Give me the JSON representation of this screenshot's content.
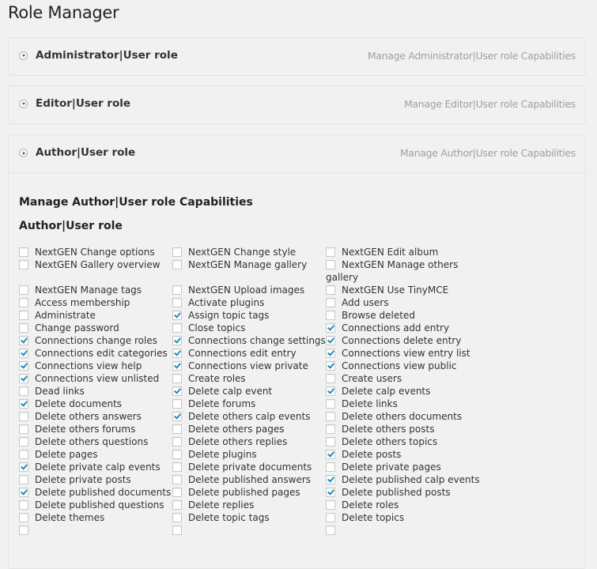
{
  "page": {
    "title": "Role Manager"
  },
  "colors": {
    "check": "#1e8cbe",
    "link": "#a0a0a0",
    "background": "#f1f1f1"
  },
  "roles": [
    {
      "title": "Administrator|User role",
      "link": "Manage Administrator|User role Capabilities",
      "expanded": false,
      "icon": "chevron-down-icon"
    },
    {
      "title": "Editor|User role",
      "link": "Manage Editor|User role Capabilities",
      "expanded": false,
      "icon": "chevron-down-icon"
    },
    {
      "title": "Author|User role",
      "link": "Manage Author|User role Capabilities",
      "expanded": true,
      "icon": "chevron-right-icon"
    }
  ],
  "author_panel": {
    "caps_title": "Manage Author|User role Capabilities",
    "role_title": "Author|User role",
    "rows": [
      [
        {
          "label": "NextGEN Change options",
          "checked": false
        },
        {
          "label": "NextGEN Change style",
          "checked": false
        },
        {
          "label": "NextGEN Edit album",
          "checked": false
        }
      ],
      [
        {
          "label": "NextGEN Gallery overview",
          "checked": false
        },
        {
          "label": "NextGEN Manage gallery",
          "checked": false
        },
        {
          "label": "NextGEN Manage others gallery",
          "checked": false
        }
      ],
      [
        {
          "label": "NextGEN Manage tags",
          "checked": false
        },
        {
          "label": "NextGEN Upload images",
          "checked": false
        },
        {
          "label": "NextGEN Use TinyMCE",
          "checked": false
        }
      ],
      [
        {
          "label": "Access membership",
          "checked": false
        },
        {
          "label": "Activate plugins",
          "checked": false
        },
        {
          "label": "Add users",
          "checked": false
        }
      ],
      [
        {
          "label": "Administrate",
          "checked": false
        },
        {
          "label": "Assign topic tags",
          "checked": true
        },
        {
          "label": "Browse deleted",
          "checked": false
        }
      ],
      [
        {
          "label": "Change password",
          "checked": false
        },
        {
          "label": "Close topics",
          "checked": false
        },
        {
          "label": "Connections add entry",
          "checked": true
        }
      ],
      [
        {
          "label": "Connections change roles",
          "checked": true
        },
        {
          "label": "Connections change settings",
          "checked": true
        },
        {
          "label": "Connections delete entry",
          "checked": true
        }
      ],
      [
        {
          "label": "Connections edit categories",
          "checked": true
        },
        {
          "label": "Connections edit entry",
          "checked": true
        },
        {
          "label": "Connections view entry list",
          "checked": true
        }
      ],
      [
        {
          "label": "Connections view help",
          "checked": true
        },
        {
          "label": "Connections view private",
          "checked": true
        },
        {
          "label": "Connections view public",
          "checked": true
        }
      ],
      [
        {
          "label": "Connections view unlisted",
          "checked": true
        },
        {
          "label": "Create roles",
          "checked": false
        },
        {
          "label": "Create users",
          "checked": false
        }
      ],
      [
        {
          "label": "Dead links",
          "checked": false
        },
        {
          "label": "Delete calp event",
          "checked": true
        },
        {
          "label": "Delete calp events",
          "checked": true
        }
      ],
      [
        {
          "label": "Delete documents",
          "checked": true
        },
        {
          "label": "Delete forums",
          "checked": false
        },
        {
          "label": "Delete links",
          "checked": false
        }
      ],
      [
        {
          "label": "Delete others answers",
          "checked": false
        },
        {
          "label": "Delete others calp events",
          "checked": true
        },
        {
          "label": "Delete others documents",
          "checked": false
        }
      ],
      [
        {
          "label": "Delete others forums",
          "checked": false
        },
        {
          "label": "Delete others pages",
          "checked": false
        },
        {
          "label": "Delete others posts",
          "checked": false
        }
      ],
      [
        {
          "label": "Delete others questions",
          "checked": false
        },
        {
          "label": "Delete others replies",
          "checked": false
        },
        {
          "label": "Delete others topics",
          "checked": false
        }
      ],
      [
        {
          "label": "Delete pages",
          "checked": false
        },
        {
          "label": "Delete plugins",
          "checked": false
        },
        {
          "label": "Delete posts",
          "checked": true
        }
      ],
      [
        {
          "label": "Delete private calp events",
          "checked": true
        },
        {
          "label": "Delete private documents",
          "checked": false
        },
        {
          "label": "Delete private pages",
          "checked": false
        }
      ],
      [
        {
          "label": "Delete private posts",
          "checked": false
        },
        {
          "label": "Delete published answers",
          "checked": false
        },
        {
          "label": "Delete published calp events",
          "checked": true
        }
      ],
      [
        {
          "label": "Delete published documents",
          "checked": true
        },
        {
          "label": "Delete published pages",
          "checked": false
        },
        {
          "label": "Delete published posts",
          "checked": true
        }
      ],
      [
        {
          "label": "Delete published questions",
          "checked": false
        },
        {
          "label": "Delete replies",
          "checked": false
        },
        {
          "label": "Delete roles",
          "checked": false
        }
      ],
      [
        {
          "label": "Delete themes",
          "checked": false
        },
        {
          "label": "Delete topic tags",
          "checked": false
        },
        {
          "label": "Delete topics",
          "checked": false
        }
      ],
      [
        {
          "label": "",
          "checked": false
        },
        {
          "label": "",
          "checked": false
        },
        {
          "label": "",
          "checked": false
        }
      ]
    ]
  }
}
